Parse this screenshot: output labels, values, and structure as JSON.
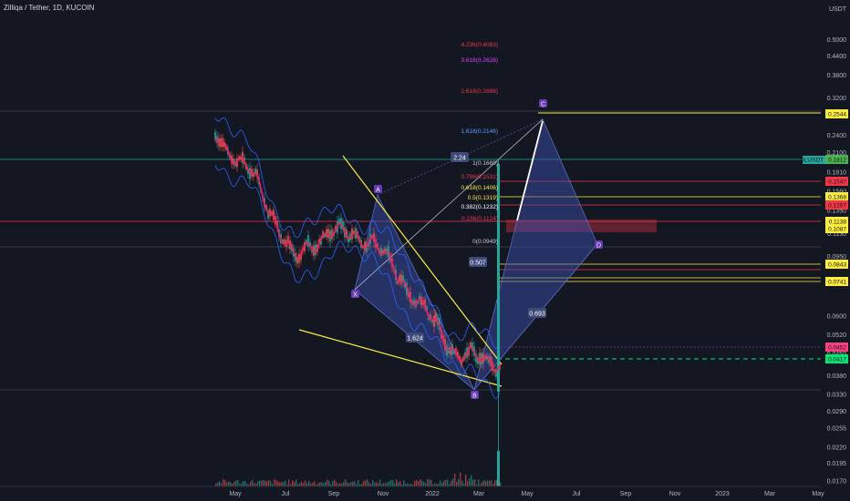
{
  "header": {
    "symbol_title": "Zilliqa / Tether, 1D, KUCOIN"
  },
  "colors": {
    "background": "#131722",
    "pink_line": "#e91e63",
    "bollinger": "#2962ff",
    "candle_up": "#26a69a",
    "candle_down": "#ef5350",
    "trendline": "#ffeb3b",
    "pattern_fill": "#3f51b5",
    "white_line": "#ffffff",
    "green_dashed": "#00e676",
    "red_level": "#f23645",
    "purple_dotted": "#9c27b0"
  },
  "chart_data": {
    "type": "line",
    "title": "",
    "yscale": "log",
    "ylim": [
      0.017,
      0.58
    ],
    "y_axis_unit": "USDT",
    "y_ticks": [
      "0.5000",
      "0.4400",
      "0.3800",
      "0.3200",
      "0.2800",
      "0.2400",
      "0.2100",
      "0.1810",
      "0.1560",
      "0.1350",
      "0.1130",
      "0.0950",
      "0.0790",
      "0.0600",
      "0.0520",
      "0.0450",
      "0.0380",
      "0.0330",
      "0.0290",
      "0.0255",
      "0.0220",
      "0.0195",
      "0.0170"
    ],
    "x_ticks": [
      "May",
      "Jul",
      "Sep",
      "Nov",
      "2022",
      "Mar",
      "May",
      "Jul",
      "Sep",
      "Nov",
      "2023",
      "Mar",
      "May"
    ],
    "series": [
      {
        "x": [
          "Apr 2021",
          "May 2021",
          "Jun 2021",
          "Jul 2021",
          "Aug 2021",
          "Sep 2021",
          "Oct 2021",
          "Nov 2021",
          "Dec 2021",
          "Jan 2022",
          "Feb 2022",
          "Mar 2022",
          "Mar 2022"
        ],
        "values": [
          0.19,
          0.17,
          0.12,
          0.065,
          0.078,
          0.105,
          0.1,
          0.085,
          0.072,
          0.052,
          0.043,
          0.042,
          0.115
        ]
      }
    ],
    "harmonic_pattern": {
      "points": [
        {
          "label": "X",
          "price": 0.07
        },
        {
          "label": "A",
          "price": 0.133
        },
        {
          "label": "B",
          "price": 0.033
        },
        {
          "label": "C",
          "price": 0.248
        },
        {
          "label": "D",
          "price": 0.099
        }
      ],
      "ratios": [
        "1.624",
        "0.507",
        "2.24",
        "0.693"
      ]
    },
    "fib_levels": [
      {
        "label": "4.236(0.4083)",
        "price": 0.4083
      },
      {
        "label": "3.618(0.2626)",
        "price": 0.365
      },
      {
        "label": "2.618(0.2886)",
        "price": 0.295
      },
      {
        "label": "1.618(0.2146)",
        "price": 0.2146
      },
      {
        "label": "1(0.1689)",
        "price": 0.1689
      },
      {
        "label": "0.786(0.1531)",
        "price": 0.1531
      },
      {
        "label": "0.618(0.1406)",
        "price": 0.1406
      },
      {
        "label": "0.5(0.1319)",
        "price": 0.1319
      },
      {
        "label": "0.382(0.1232)",
        "price": 0.1232
      },
      {
        "label": "0.236(0.1124)",
        "price": 0.1124
      },
      {
        "label": "0(0.0949)",
        "price": 0.0949
      }
    ],
    "price_badges": [
      {
        "label": "0.2544",
        "price": 0.2544,
        "color": "#ffeb3b"
      },
      {
        "label": "0.1812",
        "price": 0.1812,
        "color": "#4caf50"
      },
      {
        "label": "0.1547",
        "price": 0.1547,
        "color": "#f23645"
      },
      {
        "label": "0.1368",
        "price": 0.1368,
        "color": "#ffeb3b"
      },
      {
        "label": "0.1297",
        "price": 0.1297,
        "color": "#f23645"
      },
      {
        "label": "0.1138",
        "price": 0.1138,
        "color": "#ffeb3b"
      },
      {
        "label": "0.1087",
        "price": 0.1087,
        "color": "#ffeb3b"
      },
      {
        "label": "0.0843",
        "price": 0.0843,
        "color": "#ffeb3b"
      },
      {
        "label": "0.0741",
        "price": 0.0741,
        "color": "#ffeb3b"
      },
      {
        "label": "0.0452",
        "price": 0.0452,
        "color": "#ff4081"
      },
      {
        "label": "0.0417",
        "price": 0.0417,
        "color": "#00e676"
      }
    ],
    "current_price_tag": {
      "label": "ZILUSDT",
      "price": 0.1812
    }
  }
}
